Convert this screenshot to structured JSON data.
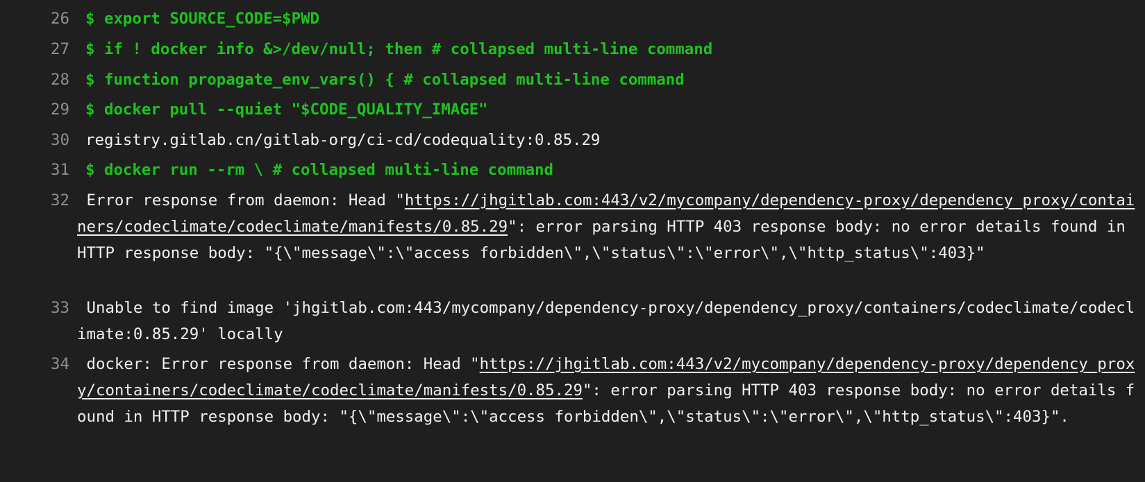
{
  "lines": [
    {
      "num": "26",
      "text": "$ export SOURCE_CODE=$PWD"
    },
    {
      "num": "27",
      "text": "$ if ! docker info &>/dev/null; then # collapsed multi-line command"
    },
    {
      "num": "28",
      "text": "$ function propagate_env_vars() { # collapsed multi-line command"
    },
    {
      "num": "29",
      "text": "$ docker pull --quiet \"$CODE_QUALITY_IMAGE\""
    },
    {
      "num": "30",
      "text": "registry.gitlab.cn/gitlab-org/ci-cd/codequality:0.85.29"
    },
    {
      "num": "31",
      "text": "$ docker run --rm \\ # collapsed multi-line command"
    },
    {
      "num": "32",
      "prefix": "Error response from daemon: Head \"",
      "link": "https://jhgitlab.com:443/v2/mycompany/dependency-proxy/dependency_proxy/containers/codeclimate/codeclimate/manifests/0.85.29",
      "suffix": "\": error parsing HTTP 403 response body: no error details found in HTTP response body: \"{\\\"message\\\":\\\"access forbidden\\\",\\\"status\\\":\\\"error\\\",\\\"http_status\\\":403}\""
    },
    {
      "num": "33",
      "text": "Unable to find image 'jhgitlab.com:443/mycompany/dependency-proxy/dependency_proxy/containers/codeclimate/codeclimate:0.85.29' locally"
    },
    {
      "num": "34",
      "prefix": "docker: Error response from daemon: Head \"",
      "link": "https://jhgitlab.com:443/v2/mycompany/dependency-proxy/dependency_proxy/containers/codeclimate/codeclimate/manifests/0.85.29",
      "suffix": "\": error parsing HTTP 403 response body: no error details found in HTTP response body: \"{\\\"message\\\":\\\"access forbidden\\\",\\\"status\\\":\\\"error\\\",\\\"http_status\\\":403}\"."
    }
  ]
}
